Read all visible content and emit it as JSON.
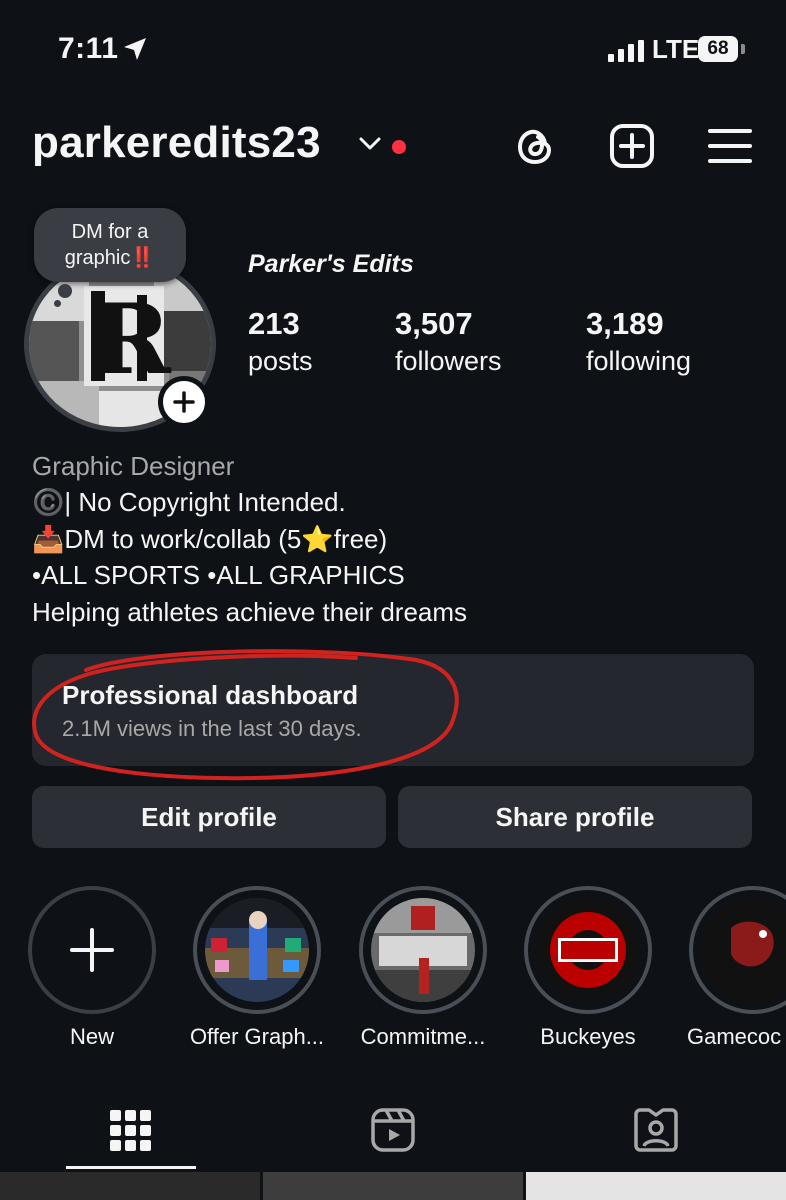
{
  "status_bar": {
    "time": "7:11",
    "network": "LTE",
    "battery": "68",
    "icons": [
      "location-arrow-icon",
      "signal-bars-icon",
      "battery-icon"
    ]
  },
  "header": {
    "username": "parkeredits23",
    "has_unread_dot": true,
    "icons": [
      "chevron-down-icon",
      "threads-icon",
      "create-plus-icon",
      "menu-icon"
    ]
  },
  "note": {
    "line1": "DM for a",
    "line2": "graphic‼️"
  },
  "profile": {
    "display_name": "Parker's Edits",
    "stats": [
      {
        "value": "213",
        "label": "posts"
      },
      {
        "value": "3,507",
        "label": "followers"
      },
      {
        "value": "3,189",
        "label": "following"
      }
    ]
  },
  "bio": {
    "category": "Graphic Designer",
    "lines": [
      "©️| No Copyright Intended.",
      "📥DM to work/collab (5⭐️free)",
      "•ALL SPORTS •ALL GRAPHICS",
      "Helping athletes achieve their dreams"
    ]
  },
  "dashboard": {
    "title": "Professional dashboard",
    "subtitle": "2.1M views in the last 30 days."
  },
  "buttons": {
    "edit_profile": "Edit profile",
    "share_profile": "Share profile"
  },
  "highlights": [
    {
      "label": "New"
    },
    {
      "label": "Offer Graph..."
    },
    {
      "label": "Commitme..."
    },
    {
      "label": "Buckeyes"
    },
    {
      "label": "Gamecoc"
    }
  ],
  "tabs": [
    "grid-icon",
    "reels-icon",
    "tagged-icon"
  ],
  "colors": {
    "background": "#0e1116",
    "accent_red": "#ff3040",
    "annotation_red": "#d0231f",
    "ohio_state_red": "#bb0000"
  }
}
